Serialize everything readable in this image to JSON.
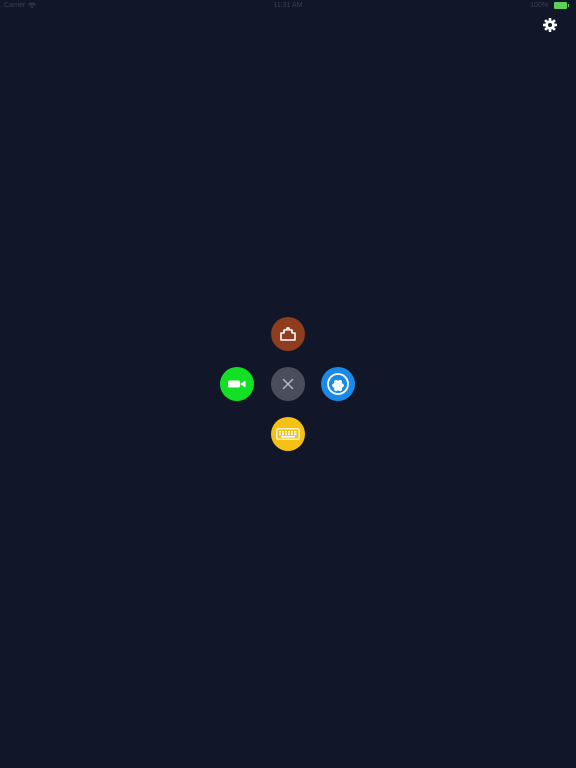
{
  "status_bar": {
    "carrier": "Carrier",
    "time": "11:31 AM",
    "battery": "100%"
  },
  "settings": {
    "icon": "gear-icon"
  },
  "radial_menu": {
    "center": {
      "icon": "close-icon",
      "color": "#4a4e5c"
    },
    "top": {
      "icon": "ethernet-port-icon",
      "color": "#8f3d1f"
    },
    "left": {
      "icon": "camera-icon",
      "color": "#13e025"
    },
    "right": {
      "icon": "serial-connector-icon",
      "color": "#1a8ae8"
    },
    "bottom": {
      "icon": "keyboard-icon",
      "color": "#f5c114"
    }
  },
  "colors": {
    "background": "#111728",
    "status_text": "#3c4150",
    "battery": "#5ed05a"
  }
}
